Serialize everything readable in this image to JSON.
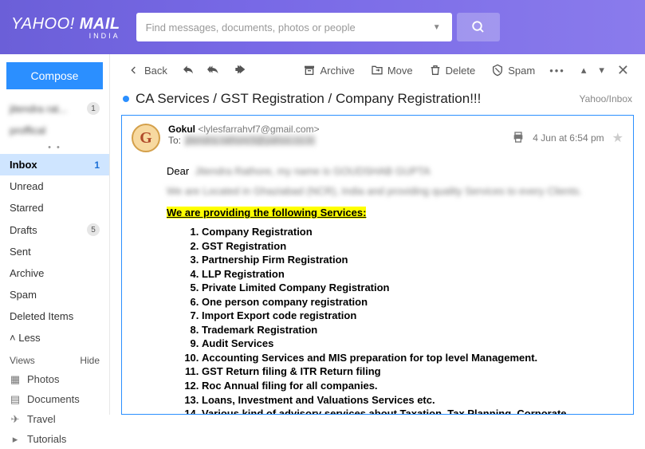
{
  "brand": {
    "name": "YAHOO!",
    "product": "MAIL",
    "region": "INDIA"
  },
  "search": {
    "placeholder": "Find messages, documents, photos or people"
  },
  "compose_label": "Compose",
  "accounts": [
    {
      "name": "jitendra rat...",
      "count": "1"
    },
    {
      "name": "proffical",
      "count": ""
    }
  ],
  "folders": [
    {
      "key": "inbox",
      "label": "Inbox",
      "count": "1",
      "selected": true
    },
    {
      "key": "unread",
      "label": "Unread"
    },
    {
      "key": "starred",
      "label": "Starred"
    },
    {
      "key": "drafts",
      "label": "Drafts",
      "count": "5"
    },
    {
      "key": "sent",
      "label": "Sent"
    },
    {
      "key": "archive",
      "label": "Archive"
    },
    {
      "key": "spam",
      "label": "Spam"
    },
    {
      "key": "deleted",
      "label": "Deleted Items"
    }
  ],
  "less_label": "Less",
  "views_header": "Views",
  "hide_label": "Hide",
  "views": [
    {
      "icon": "photo",
      "label": "Photos"
    },
    {
      "icon": "doc",
      "label": "Documents"
    },
    {
      "icon": "plane",
      "label": "Travel"
    },
    {
      "icon": "video",
      "label": "Tutorials"
    }
  ],
  "toolbar": {
    "back": "Back",
    "archive": "Archive",
    "move": "Move",
    "delete": "Delete",
    "spam": "Spam"
  },
  "message": {
    "subject": "CA Services / GST Registration / Company Registration!!!",
    "folder_path": "Yahoo/Inbox",
    "from_name": "Gokul",
    "from_addr": "<lylesfarrahvf7@gmail.com>",
    "to_label": "To:",
    "to_blurred": "jitendra.rathore3@yahoo.co.in",
    "avatar_letter": "G",
    "date": "4 Jun at 6:54 pm",
    "dear": "Dear",
    "dear_blurred": "Jitendra Rathore, my name is GOUDSHAB GUPTA",
    "loc_blurred": "We are Located in Ghaziabad (NCR), India and providing quality Services to every Clients.",
    "services_heading": "We are providing the following Services:",
    "services": [
      "Company Registration",
      "GST Registration",
      "Partnership Firm Registration",
      "LLP Registration",
      "Private Limited Company Registration",
      "One person company registration",
      "Import Export code registration",
      "Trademark Registration",
      "Audit Services",
      "Accounting Services and MIS preparation for top level Management.",
      "GST Return filing & ITR Return filing",
      "Roc Annual filing for all companies.",
      "Loans, Investment and Valuations Services etc.",
      "Various kind of advisory services about Taxation, Tax Planning, Corporate Restructuring, Business Planning etc."
    ]
  }
}
